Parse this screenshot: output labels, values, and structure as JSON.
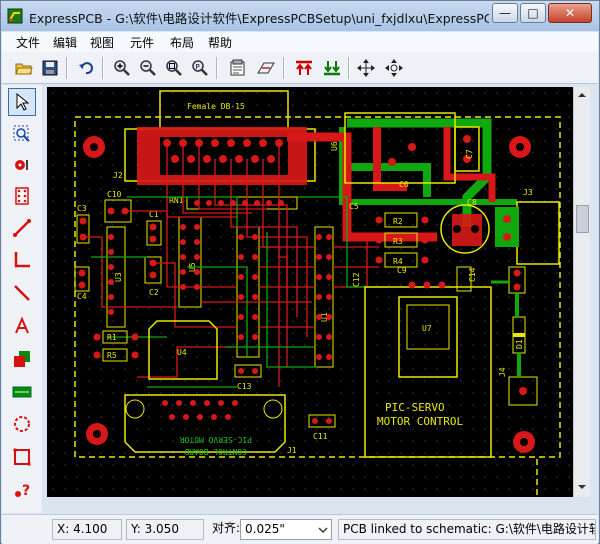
{
  "window": {
    "title": "ExpressPCB - G:\\软件\\电路设计软件\\ExpressPCBSetup\\uni_fxjdlxu\\ExpressPCB...",
    "minimize": "—",
    "maximize": "□",
    "close": "✕"
  },
  "menu": [
    "文件",
    "编辑",
    "视图",
    "元件",
    "布局",
    "帮助"
  ],
  "toolbar": {
    "icons": [
      "open-folder-icon",
      "save-icon",
      "undo-icon",
      "zoom-in-icon",
      "zoom-out-icon",
      "zoom-fit-icon",
      "zoom-previous-icon",
      "properties-icon",
      "pcb-link-icon",
      "top-layer-icon",
      "bottom-layer-icon",
      "pan-icon",
      "pan-center-icon"
    ]
  },
  "left_toolbar": {
    "tools": [
      "pointer-tool",
      "zoom-select-tool",
      "pad-tool",
      "component-tool",
      "trace-tool",
      "corner-trace-tool",
      "diagonal-trace-tool",
      "text-tool",
      "layer-swap-tool",
      "filled-plane-tool",
      "circle-tool",
      "rectangle-tool",
      "help-tool",
      "connections-tool"
    ]
  },
  "board": {
    "labels": {
      "female_db15": "Female DB-15",
      "j2": "J2",
      "rn1": "RN1",
      "c10": "C10",
      "c3": "C3",
      "c1": "C1",
      "c4": "C4",
      "c2": "C2",
      "u5": "U5",
      "u3": "U3",
      "r1": "R1",
      "r5": "R5",
      "u4": "U4",
      "c13": "C13",
      "c11": "C11",
      "u1": "U1",
      "c5": "C5",
      "c6": "C6",
      "c7": "C7",
      "c8": "C8",
      "j3": "J3",
      "r2": "R2",
      "r3": "R3",
      "r4": "R4",
      "c9": "C9",
      "c12": "C12",
      "c14": "C14",
      "u7": "U7",
      "d1": "D1",
      "j4": "J4",
      "j1": "J1",
      "pic_servo_top": "PIC-SERVO",
      "motor_control_top": "MOTOR CONTROL",
      "pic_servo_bottom": "PIC-SERVO MOTOR",
      "control_board_bottom": "CONTROL BOARD"
    }
  },
  "status": {
    "x": "X: 4.100",
    "y": "Y: 3.050",
    "align_label": "对齐:",
    "align_value": "0.025\"",
    "link_text": "PCB linked to schematic:  G:\\软件\\电路设计软件"
  }
}
